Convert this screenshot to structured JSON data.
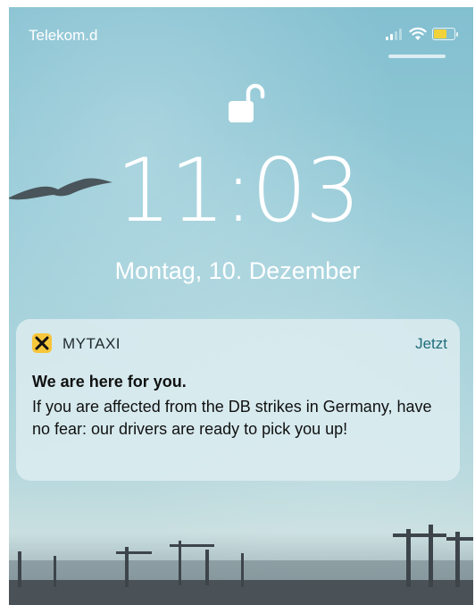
{
  "status_bar": {
    "carrier": "Telekom.d",
    "icons": [
      "signal-icon",
      "wifi-icon",
      "battery-icon"
    ],
    "battery_color": "#f2d23a"
  },
  "lock_screen": {
    "time": "11:03",
    "date": "Montag, 10. Dezember"
  },
  "notification": {
    "app_name": "MYTAXI",
    "time": "Jetzt",
    "title": "We are here for you.",
    "body": "If you are affected from the DB strikes in Germany, have no fear: our drivers are ready to pick you up!",
    "app_icon_color": "#f7c63b"
  }
}
